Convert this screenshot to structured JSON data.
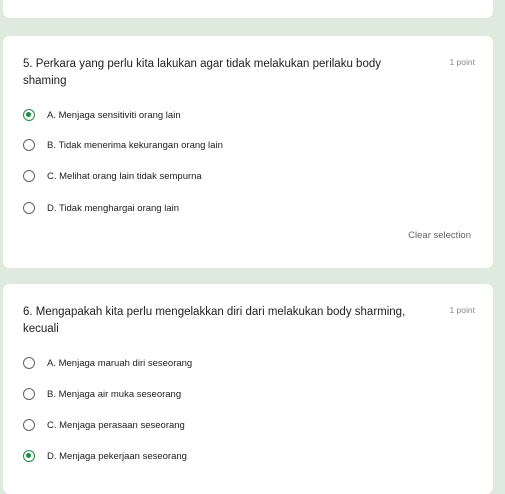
{
  "accent_color": "#1e8e3e",
  "questions": [
    {
      "title": "5. Perkara yang perlu kita lakukan agar tidak melakukan perilaku body shaming",
      "points": "1 point",
      "options": [
        {
          "label": "A. Menjaga sensitiviti orang lain",
          "selected": true
        },
        {
          "label": "B. Tidak menerima kekurangan orang lain",
          "selected": false
        },
        {
          "label": "C. Melihat orang lain tidak sempurna",
          "selected": false
        },
        {
          "label": "D. Tidak menghargai orang lain",
          "selected": false
        }
      ],
      "clear_label": "Clear selection"
    },
    {
      "title": "6. Mengapakah kita perlu mengelakkan diri dari melakukan body sharming, kecuali",
      "points": "1 point",
      "options": [
        {
          "label": "A. Menjaga maruah diri seseorang",
          "selected": false
        },
        {
          "label": "B. Menjaga air muka seseorang",
          "selected": false
        },
        {
          "label": "C. Menjaga perasaan seseorang",
          "selected": false
        },
        {
          "label": "D. Menjaga pekerjaan seseorang",
          "selected": true
        }
      ]
    }
  ]
}
